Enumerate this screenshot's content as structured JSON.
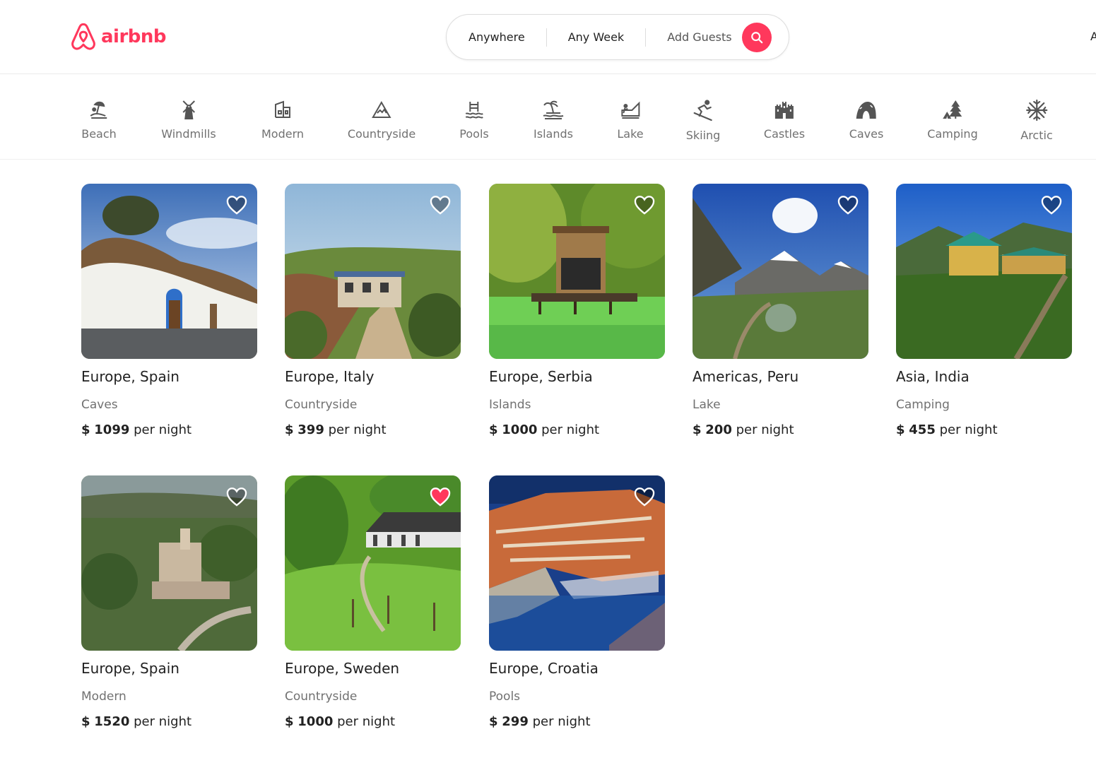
{
  "brand": {
    "name": "airbnb",
    "color": "#ff385c"
  },
  "search": {
    "where": "Anywhere",
    "when": "Any Week",
    "guests": "Add Guests",
    "button_icon": "search-icon"
  },
  "header_edge_text": "A",
  "categories": [
    {
      "label": "Beach",
      "icon": "beach-icon"
    },
    {
      "label": "Windmills",
      "icon": "windmill-icon"
    },
    {
      "label": "Modern",
      "icon": "modern-house-icon"
    },
    {
      "label": "Countryside",
      "icon": "mountain-icon"
    },
    {
      "label": "Pools",
      "icon": "pool-icon"
    },
    {
      "label": "Islands",
      "icon": "island-icon"
    },
    {
      "label": "Lake",
      "icon": "lake-icon"
    },
    {
      "label": "Skiing",
      "icon": "skiing-icon"
    },
    {
      "label": "Castles",
      "icon": "castle-icon"
    },
    {
      "label": "Caves",
      "icon": "cave-icon"
    },
    {
      "label": "Camping",
      "icon": "camping-icon"
    },
    {
      "label": "Arctic",
      "icon": "snowflake-icon"
    }
  ],
  "listings": [
    {
      "title": "Europe, Spain",
      "category": "Caves",
      "currency": "$",
      "price": "1099",
      "unit": "per night",
      "favorite": false
    },
    {
      "title": "Europe, Italy",
      "category": "Countryside",
      "currency": "$",
      "price": "399",
      "unit": "per night",
      "favorite": false
    },
    {
      "title": "Europe, Serbia",
      "category": "Islands",
      "currency": "$",
      "price": "1000",
      "unit": "per night",
      "favorite": false
    },
    {
      "title": "Americas, Peru",
      "category": "Lake",
      "currency": "$",
      "price": "200",
      "unit": "per night",
      "favorite": false
    },
    {
      "title": "Asia, India",
      "category": "Camping",
      "currency": "$",
      "price": "455",
      "unit": "per night",
      "favorite": false
    },
    {
      "title": "Europe, Spain",
      "category": "Modern",
      "currency": "$",
      "price": "1520",
      "unit": "per night",
      "favorite": false
    },
    {
      "title": "Europe, Sweden",
      "category": "Countryside",
      "currency": "$",
      "price": "1000",
      "unit": "per night",
      "favorite": true
    },
    {
      "title": "Europe, Croatia",
      "category": "Pools",
      "currency": "$",
      "price": "299",
      "unit": "per night",
      "favorite": false
    }
  ],
  "colors": {
    "heart_favorite": "#ff385c",
    "heart_default": "rgba(0,0,0,0.35)",
    "text_muted": "#717171"
  }
}
